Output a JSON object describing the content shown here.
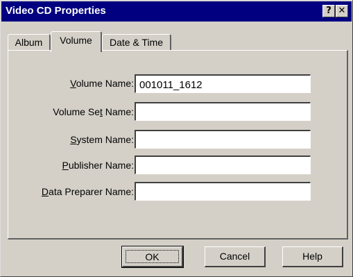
{
  "window": {
    "title": "Video CD Properties",
    "help_glyph": "?",
    "close_glyph": "✕"
  },
  "tabs": [
    {
      "label": "Album",
      "active": false
    },
    {
      "label": "Volume",
      "active": true
    },
    {
      "label": "Date & Time",
      "active": false
    }
  ],
  "fields": [
    {
      "label": "Volume Name:",
      "value": "001011_1612",
      "underline_char": "V"
    },
    {
      "label": "Volume Set Name:",
      "value": "",
      "underline_char": "t"
    },
    {
      "label": "System Name:",
      "value": "",
      "underline_char": "S"
    },
    {
      "label": "Publisher Name:",
      "value": "",
      "underline_char": "P"
    },
    {
      "label": "Data Preparer Name:",
      "value": "",
      "underline_char": "D"
    }
  ],
  "buttons": {
    "ok": "OK",
    "cancel": "Cancel",
    "help": "Help"
  },
  "colors": {
    "titlebar": "#000080",
    "face": "#d4d0c8"
  }
}
